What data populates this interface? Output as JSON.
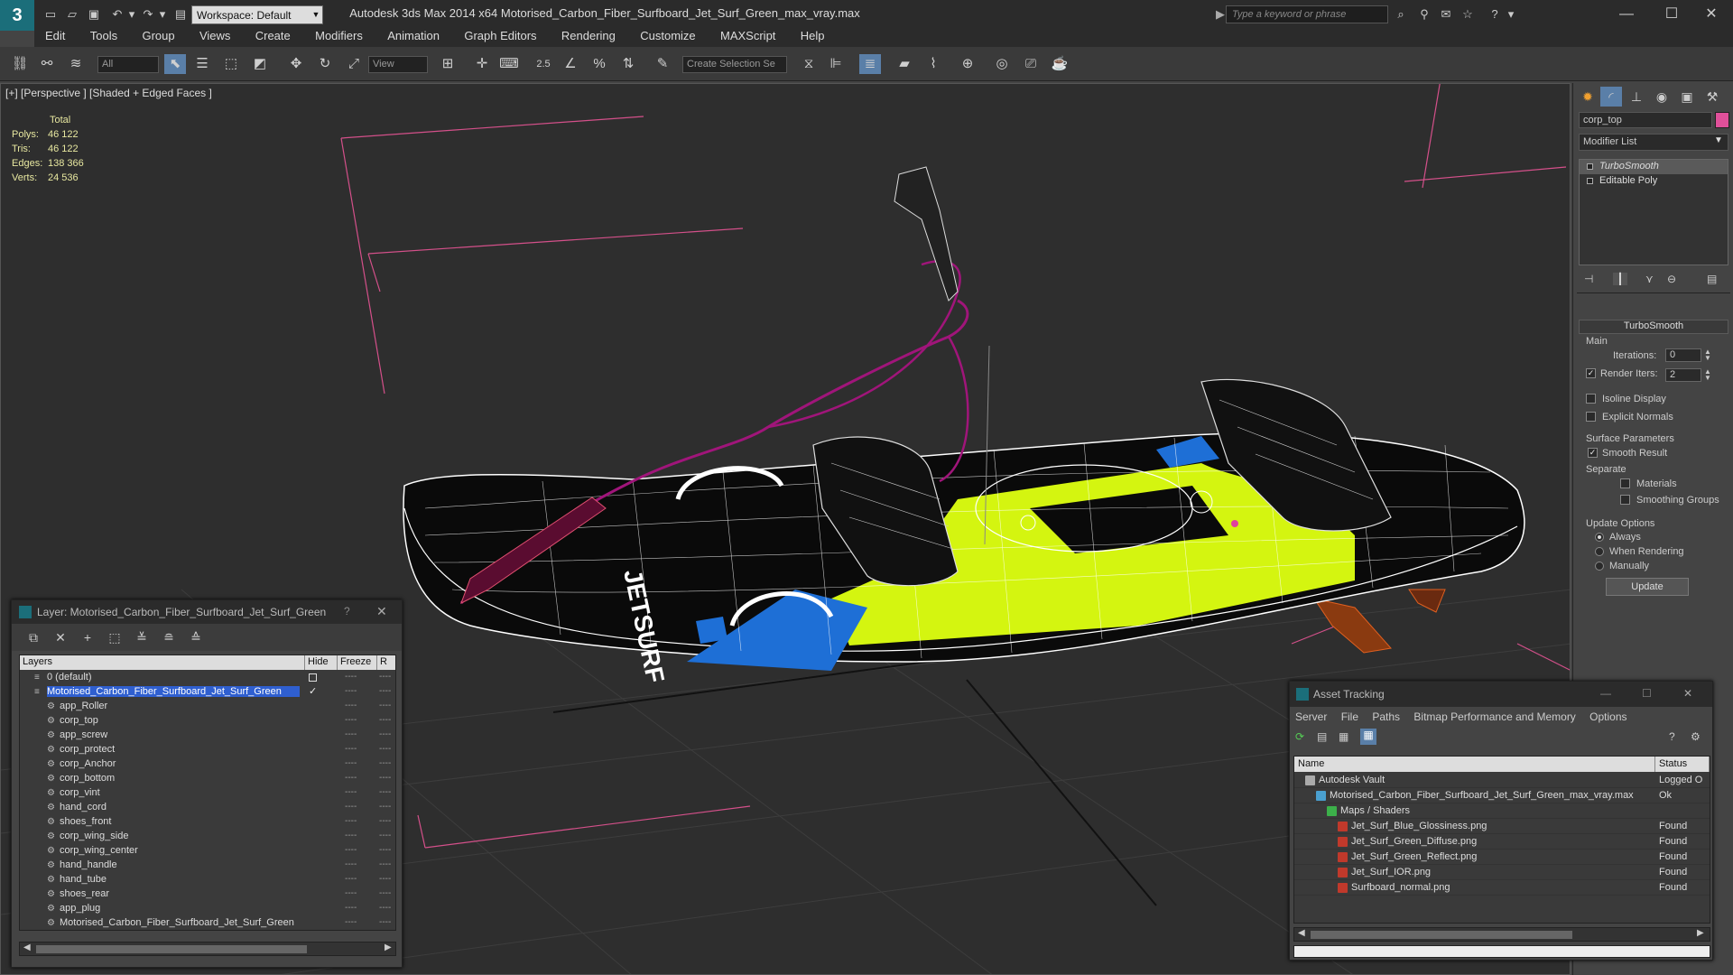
{
  "window": {
    "title": "Autodesk 3ds Max  2014 x64     Motorised_Carbon_Fiber_Surfboard_Jet_Surf_Green_max_vray.max",
    "workspace": "Workspace: Default",
    "search_placeholder": "Type a keyword or phrase"
  },
  "menu": [
    "Edit",
    "Tools",
    "Group",
    "Views",
    "Create",
    "Modifiers",
    "Animation",
    "Graph Editors",
    "Rendering",
    "Customize",
    "MAXScript",
    "Help"
  ],
  "toolbar": {
    "filter_value": "All",
    "view_value": "View",
    "selection_set_placeholder": "Create Selection Se",
    "snap_label": "2.5"
  },
  "viewport": {
    "label": "[+] [Perspective ] [Shaded + Edged Faces ]",
    "stats": {
      "header": "Total",
      "rows": [
        {
          "label": "Polys:",
          "value": "46 122"
        },
        {
          "label": "Tris:",
          "value": "46 122"
        },
        {
          "label": "Edges:",
          "value": "138 366"
        },
        {
          "label": "Verts:",
          "value": "24 536"
        }
      ]
    },
    "board_text": "JETSURF"
  },
  "command_panel": {
    "object_name": "corp_top",
    "object_color": "#e0509a",
    "modifier_list": "Modifier List",
    "stack": [
      "TurboSmooth",
      "Editable Poly"
    ],
    "turbosmooth": {
      "title": "TurboSmooth",
      "main": "Main",
      "iterations_label": "Iterations:",
      "iterations": "0",
      "render_iters_label": "Render Iters:",
      "render_iters": "2",
      "render_iters_checked": true,
      "isoline": "Isoline Display",
      "explicit_normals": "Explicit Normals",
      "surface_params": "Surface Parameters",
      "smooth_result": "Smooth Result",
      "separate": "Separate",
      "materials": "Materials",
      "smoothing_groups": "Smoothing Groups",
      "update_options": "Update Options",
      "always": "Always",
      "when_rendering": "When Rendering",
      "manually": "Manually",
      "update_button": "Update"
    }
  },
  "layer_dialog": {
    "title": "Layer: Motorised_Carbon_Fiber_Surfboard_Jet_Surf_Green",
    "help": "?",
    "columns": {
      "layers": "Layers",
      "hide": "Hide",
      "freeze": "Freeze",
      "render": "R"
    },
    "layers": [
      {
        "name": "0 (default)",
        "level": 0
      },
      {
        "name": "Motorised_Carbon_Fiber_Surfboard_Jet_Surf_Green",
        "level": 0,
        "selected": true
      },
      {
        "name": "app_Roller",
        "level": 1
      },
      {
        "name": "corp_top",
        "level": 1
      },
      {
        "name": "app_screw",
        "level": 1
      },
      {
        "name": "corp_protect",
        "level": 1
      },
      {
        "name": "corp_Anchor",
        "level": 1
      },
      {
        "name": "corp_bottom",
        "level": 1
      },
      {
        "name": "corp_vint",
        "level": 1
      },
      {
        "name": "hand_cord",
        "level": 1
      },
      {
        "name": "shoes_front",
        "level": 1
      },
      {
        "name": "corp_wing_side",
        "level": 1
      },
      {
        "name": "corp_wing_center",
        "level": 1
      },
      {
        "name": "hand_handle",
        "level": 1
      },
      {
        "name": "hand_tube",
        "level": 1
      },
      {
        "name": "shoes_rear",
        "level": 1
      },
      {
        "name": "app_plug",
        "level": 1
      },
      {
        "name": "Motorised_Carbon_Fiber_Surfboard_Jet_Surf_Green",
        "level": 1
      }
    ],
    "dash": "----"
  },
  "asset_dialog": {
    "title": "Asset Tracking",
    "menu": [
      "Server",
      "File",
      "Paths",
      "Bitmap Performance and Memory",
      "Options"
    ],
    "columns": {
      "name": "Name",
      "status": "Status"
    },
    "rows": [
      {
        "name": "Autodesk Vault",
        "status": "Logged O",
        "level": 0,
        "kind": "vault"
      },
      {
        "name": "Motorised_Carbon_Fiber_Surfboard_Jet_Surf_Green_max_vray.max",
        "status": "Ok",
        "level": 1,
        "kind": "max"
      },
      {
        "name": "Maps / Shaders",
        "status": "",
        "level": 2,
        "kind": "maps"
      },
      {
        "name": "Jet_Surf_Blue_Glossiness.png",
        "status": "Found",
        "level": 3,
        "kind": "file"
      },
      {
        "name": "Jet_Surf_Green_Diffuse.png",
        "status": "Found",
        "level": 3,
        "kind": "file"
      },
      {
        "name": "Jet_Surf_Green_Reflect.png",
        "status": "Found",
        "level": 3,
        "kind": "file"
      },
      {
        "name": "Jet_Surf_IOR.png",
        "status": "Found",
        "level": 3,
        "kind": "file"
      },
      {
        "name": "Surfboard_normal.png",
        "status": "Found",
        "level": 3,
        "kind": "file"
      }
    ]
  }
}
